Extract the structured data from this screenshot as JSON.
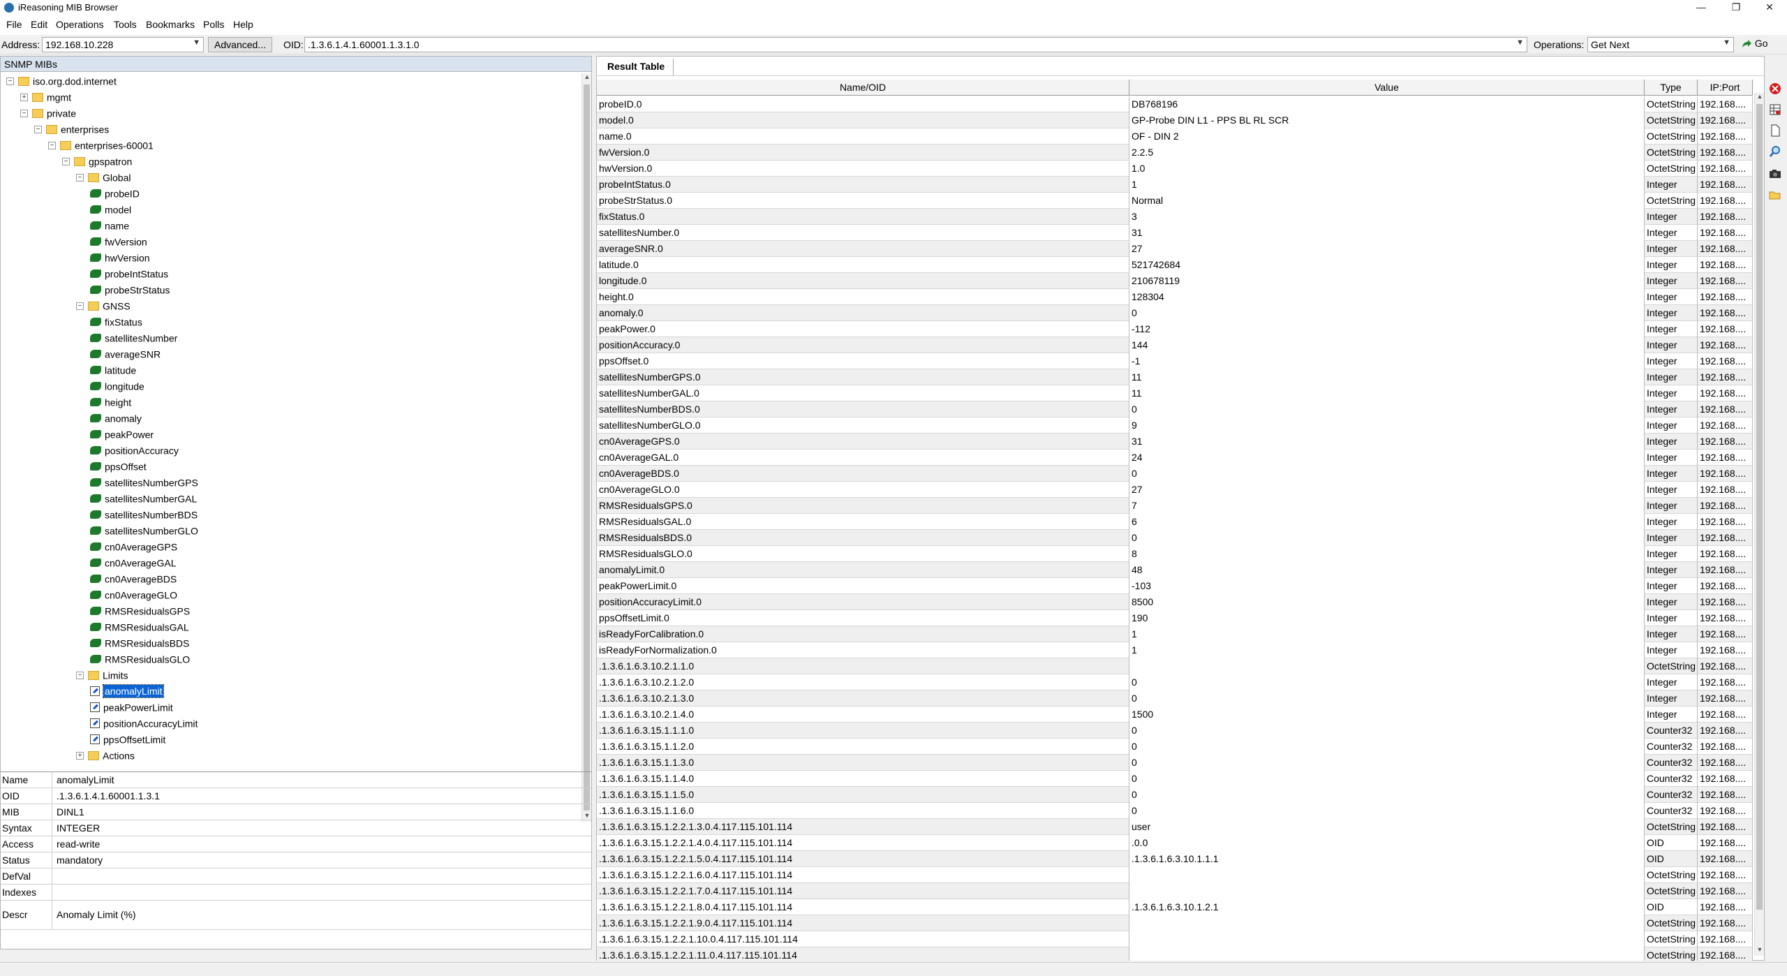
{
  "window": {
    "title": "iReasoning MIB Browser",
    "minimize": "—",
    "restore": "❐",
    "close": "✕"
  },
  "menu": [
    "File",
    "Edit",
    "Operations",
    "Tools",
    "Bookmarks",
    "Polls",
    "Help"
  ],
  "address_bar": {
    "address_label": "Address:",
    "address_value": "192.168.10.228",
    "advanced_label": "Advanced...",
    "oid_label": "OID:",
    "oid_value": ".1.3.6.1.4.1.60001.1.3.1.0",
    "operations_label": "Operations:",
    "operations_value": "Get Next",
    "go_label": "Go"
  },
  "tree_panel": {
    "header": "SNMP MIBs",
    "nodes": [
      {
        "label": "iso.org.dod.internet",
        "depth": 0,
        "kind": "folder",
        "exp": "−"
      },
      {
        "label": "mgmt",
        "depth": 1,
        "kind": "folder",
        "exp": "+"
      },
      {
        "label": "private",
        "depth": 1,
        "kind": "folder",
        "exp": "−"
      },
      {
        "label": "enterprises",
        "depth": 2,
        "kind": "folder",
        "exp": "−"
      },
      {
        "label": "enterprises-60001",
        "depth": 3,
        "kind": "folder",
        "exp": "−"
      },
      {
        "label": "gpspatron",
        "depth": 4,
        "kind": "folder",
        "exp": "−"
      },
      {
        "label": "Global",
        "depth": 5,
        "kind": "folder",
        "exp": "−"
      },
      {
        "label": "probeID",
        "depth": 6,
        "kind": "leaf"
      },
      {
        "label": "model",
        "depth": 6,
        "kind": "leaf"
      },
      {
        "label": "name",
        "depth": 6,
        "kind": "leaf"
      },
      {
        "label": "fwVersion",
        "depth": 6,
        "kind": "leaf"
      },
      {
        "label": "hwVersion",
        "depth": 6,
        "kind": "leaf"
      },
      {
        "label": "probeIntStatus",
        "depth": 6,
        "kind": "leaf"
      },
      {
        "label": "probeStrStatus",
        "depth": 6,
        "kind": "leaf"
      },
      {
        "label": "GNSS",
        "depth": 5,
        "kind": "folder",
        "exp": "−"
      },
      {
        "label": "fixStatus",
        "depth": 6,
        "kind": "leaf"
      },
      {
        "label": "satellitesNumber",
        "depth": 6,
        "kind": "leaf"
      },
      {
        "label": "averageSNR",
        "depth": 6,
        "kind": "leaf"
      },
      {
        "label": "latitude",
        "depth": 6,
        "kind": "leaf"
      },
      {
        "label": "longitude",
        "depth": 6,
        "kind": "leaf"
      },
      {
        "label": "height",
        "depth": 6,
        "kind": "leaf"
      },
      {
        "label": "anomaly",
        "depth": 6,
        "kind": "leaf"
      },
      {
        "label": "peakPower",
        "depth": 6,
        "kind": "leaf"
      },
      {
        "label": "positionAccuracy",
        "depth": 6,
        "kind": "leaf"
      },
      {
        "label": "ppsOffset",
        "depth": 6,
        "kind": "leaf"
      },
      {
        "label": "satellitesNumberGPS",
        "depth": 6,
        "kind": "leaf"
      },
      {
        "label": "satellitesNumberGAL",
        "depth": 6,
        "kind": "leaf"
      },
      {
        "label": "satellitesNumberBDS",
        "depth": 6,
        "kind": "leaf"
      },
      {
        "label": "satellitesNumberGLO",
        "depth": 6,
        "kind": "leaf"
      },
      {
        "label": "cn0AverageGPS",
        "depth": 6,
        "kind": "leaf"
      },
      {
        "label": "cn0AverageGAL",
        "depth": 6,
        "kind": "leaf"
      },
      {
        "label": "cn0AverageBDS",
        "depth": 6,
        "kind": "leaf"
      },
      {
        "label": "cn0AverageGLO",
        "depth": 6,
        "kind": "leaf"
      },
      {
        "label": "RMSResidualsGPS",
        "depth": 6,
        "kind": "leaf"
      },
      {
        "label": "RMSResidualsGAL",
        "depth": 6,
        "kind": "leaf"
      },
      {
        "label": "RMSResidualsBDS",
        "depth": 6,
        "kind": "leaf"
      },
      {
        "label": "RMSResidualsGLO",
        "depth": 6,
        "kind": "leaf"
      },
      {
        "label": "Limits",
        "depth": 5,
        "kind": "folder",
        "exp": "−"
      },
      {
        "label": "anomalyLimit",
        "depth": 6,
        "kind": "rw",
        "selected": true
      },
      {
        "label": "peakPowerLimit",
        "depth": 6,
        "kind": "rw"
      },
      {
        "label": "positionAccuracyLimit",
        "depth": 6,
        "kind": "rw"
      },
      {
        "label": "ppsOffsetLimit",
        "depth": 6,
        "kind": "rw"
      },
      {
        "label": "Actions",
        "depth": 5,
        "kind": "folder",
        "exp": "+"
      }
    ]
  },
  "properties": [
    {
      "key": "Name",
      "value": "anomalyLimit"
    },
    {
      "key": "OID",
      "value": ".1.3.6.1.4.1.60001.1.3.1"
    },
    {
      "key": "MIB",
      "value": "DINL1"
    },
    {
      "key": "Syntax",
      "value": "INTEGER"
    },
    {
      "key": "Access",
      "value": "read-write"
    },
    {
      "key": "Status",
      "value": "mandatory"
    },
    {
      "key": "DefVal",
      "value": ""
    },
    {
      "key": "Indexes",
      "value": ""
    },
    {
      "key": "Descr",
      "value": "Anomaly Limit (%)"
    }
  ],
  "result_table": {
    "tab_label": "Result Table",
    "columns": [
      "Name/OID",
      "Value",
      "Type",
      "IP:Port"
    ],
    "rows": [
      [
        "probeID.0",
        "DB768196",
        "OctetString",
        "192.168...."
      ],
      [
        "model.0",
        "GP-Probe DIN L1 - PPS BL RL SCR",
        "OctetString",
        "192.168...."
      ],
      [
        "name.0",
        "OF - DIN 2",
        "OctetString",
        "192.168...."
      ],
      [
        "fwVersion.0",
        "2.2.5",
        "OctetString",
        "192.168...."
      ],
      [
        "hwVersion.0",
        "1.0",
        "OctetString",
        "192.168...."
      ],
      [
        "probeIntStatus.0",
        "1",
        "Integer",
        "192.168...."
      ],
      [
        "probeStrStatus.0",
        "Normal",
        "OctetString",
        "192.168...."
      ],
      [
        "fixStatus.0",
        "3",
        "Integer",
        "192.168...."
      ],
      [
        "satellitesNumber.0",
        "31",
        "Integer",
        "192.168...."
      ],
      [
        "averageSNR.0",
        "27",
        "Integer",
        "192.168...."
      ],
      [
        "latitude.0",
        "521742684",
        "Integer",
        "192.168...."
      ],
      [
        "longitude.0",
        "210678119",
        "Integer",
        "192.168...."
      ],
      [
        "height.0",
        "128304",
        "Integer",
        "192.168...."
      ],
      [
        "anomaly.0",
        "0",
        "Integer",
        "192.168...."
      ],
      [
        "peakPower.0",
        "-112",
        "Integer",
        "192.168...."
      ],
      [
        "positionAccuracy.0",
        "144",
        "Integer",
        "192.168...."
      ],
      [
        "ppsOffset.0",
        "-1",
        "Integer",
        "192.168...."
      ],
      [
        "satellitesNumberGPS.0",
        "11",
        "Integer",
        "192.168...."
      ],
      [
        "satellitesNumberGAL.0",
        "11",
        "Integer",
        "192.168...."
      ],
      [
        "satellitesNumberBDS.0",
        "0",
        "Integer",
        "192.168...."
      ],
      [
        "satellitesNumberGLO.0",
        "9",
        "Integer",
        "192.168...."
      ],
      [
        "cn0AverageGPS.0",
        "31",
        "Integer",
        "192.168...."
      ],
      [
        "cn0AverageGAL.0",
        "24",
        "Integer",
        "192.168...."
      ],
      [
        "cn0AverageBDS.0",
        "0",
        "Integer",
        "192.168...."
      ],
      [
        "cn0AverageGLO.0",
        "27",
        "Integer",
        "192.168...."
      ],
      [
        "RMSResidualsGPS.0",
        "7",
        "Integer",
        "192.168...."
      ],
      [
        "RMSResidualsGAL.0",
        "6",
        "Integer",
        "192.168...."
      ],
      [
        "RMSResidualsBDS.0",
        "0",
        "Integer",
        "192.168...."
      ],
      [
        "RMSResidualsGLO.0",
        "8",
        "Integer",
        "192.168...."
      ],
      [
        "anomalyLimit.0",
        "48",
        "Integer",
        "192.168...."
      ],
      [
        "peakPowerLimit.0",
        "-103",
        "Integer",
        "192.168...."
      ],
      [
        "positionAccuracyLimit.0",
        "8500",
        "Integer",
        "192.168...."
      ],
      [
        "ppsOffsetLimit.0",
        "190",
        "Integer",
        "192.168...."
      ],
      [
        "isReadyForCalibration.0",
        "1",
        "Integer",
        "192.168...."
      ],
      [
        "isReadyForNormalization.0",
        "1",
        "Integer",
        "192.168...."
      ],
      [
        ".1.3.6.1.6.3.10.2.1.1.0",
        "",
        "OctetString",
        "192.168...."
      ],
      [
        ".1.3.6.1.6.3.10.2.1.2.0",
        "0",
        "Integer",
        "192.168...."
      ],
      [
        ".1.3.6.1.6.3.10.2.1.3.0",
        "0",
        "Integer",
        "192.168...."
      ],
      [
        ".1.3.6.1.6.3.10.2.1.4.0",
        "1500",
        "Integer",
        "192.168...."
      ],
      [
        ".1.3.6.1.6.3.15.1.1.1.0",
        "0",
        "Counter32",
        "192.168...."
      ],
      [
        ".1.3.6.1.6.3.15.1.1.2.0",
        "0",
        "Counter32",
        "192.168...."
      ],
      [
        ".1.3.6.1.6.3.15.1.1.3.0",
        "0",
        "Counter32",
        "192.168...."
      ],
      [
        ".1.3.6.1.6.3.15.1.1.4.0",
        "0",
        "Counter32",
        "192.168...."
      ],
      [
        ".1.3.6.1.6.3.15.1.1.5.0",
        "0",
        "Counter32",
        "192.168...."
      ],
      [
        ".1.3.6.1.6.3.15.1.1.6.0",
        "0",
        "Counter32",
        "192.168...."
      ],
      [
        ".1.3.6.1.6.3.15.1.2.2.1.3.0.4.117.115.101.114",
        "user",
        "OctetString",
        "192.168...."
      ],
      [
        ".1.3.6.1.6.3.15.1.2.2.1.4.0.4.117.115.101.114",
        ".0.0",
        "OID",
        "192.168...."
      ],
      [
        ".1.3.6.1.6.3.15.1.2.2.1.5.0.4.117.115.101.114",
        ".1.3.6.1.6.3.10.1.1.1",
        "OID",
        "192.168...."
      ],
      [
        ".1.3.6.1.6.3.15.1.2.2.1.6.0.4.117.115.101.114",
        "",
        "OctetString",
        "192.168...."
      ],
      [
        ".1.3.6.1.6.3.15.1.2.2.1.7.0.4.117.115.101.114",
        "",
        "OctetString",
        "192.168...."
      ],
      [
        ".1.3.6.1.6.3.15.1.2.2.1.8.0.4.117.115.101.114",
        ".1.3.6.1.6.3.10.1.2.1",
        "OID",
        "192.168...."
      ],
      [
        ".1.3.6.1.6.3.15.1.2.2.1.9.0.4.117.115.101.114",
        "",
        "OctetString",
        "192.168...."
      ],
      [
        ".1.3.6.1.6.3.15.1.2.2.1.10.0.4.117.115.101.114",
        "",
        "OctetString",
        "192.168...."
      ],
      [
        ".1.3.6.1.6.3.15.1.2.2.1.11.0.4.117.115.101.114",
        "",
        "OctetString",
        "192.168...."
      ]
    ]
  },
  "toolbar_icons": [
    "close-red-icon",
    "table-icon",
    "document-icon",
    "search-icon",
    "camera-icon",
    "folder-open-icon"
  ],
  "colors": {
    "selection": "#0a64d6",
    "panel_header": "#d9e3ef",
    "folder": "#f6cd56",
    "leaf": "#1d7a2a"
  }
}
